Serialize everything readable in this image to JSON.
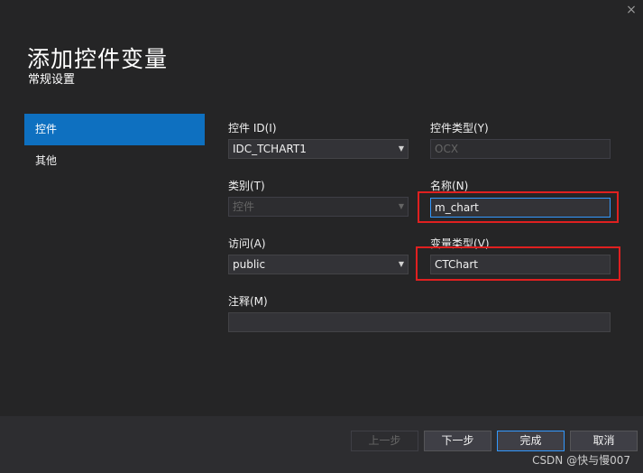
{
  "dialog": {
    "close_glyph": "×",
    "title": "添加控件变量",
    "subtitle": "常规设置"
  },
  "nav": {
    "items": [
      {
        "label": "控件",
        "active": true
      },
      {
        "label": "其他",
        "active": false
      }
    ]
  },
  "form": {
    "control_id": {
      "label": "控件 ID(I)",
      "value": "IDC_TCHART1"
    },
    "control_type": {
      "label": "控件类型(Y)",
      "value": "OCX"
    },
    "category": {
      "label": "类别(T)",
      "value": "控件"
    },
    "name": {
      "label": "名称(N)",
      "value": "m_chart"
    },
    "access": {
      "label": "访问(A)",
      "value": "public"
    },
    "variable_type": {
      "label": "变量类型(V)",
      "value": "CTChart"
    },
    "comment": {
      "label": "注释(M)",
      "value": ""
    }
  },
  "buttons": {
    "prev": "上一步",
    "next": "下一步",
    "finish": "完成",
    "cancel": "取消"
  },
  "watermark": "CSDN @快与慢007",
  "colors": {
    "accent": "#0e70c0",
    "highlight_box": "#e02020"
  }
}
